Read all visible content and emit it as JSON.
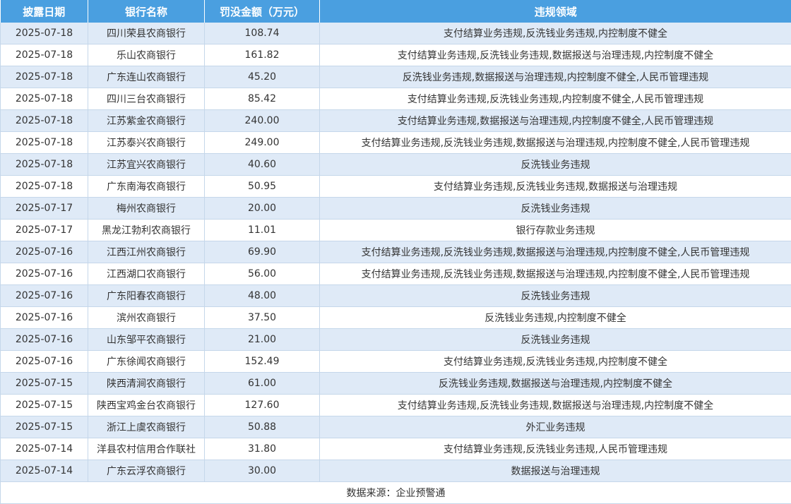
{
  "headers": [
    "披露日期",
    "银行名称",
    "罚没金额（万元）",
    "违规领域"
  ],
  "rows": [
    {
      "date": "2025-07-18",
      "bank": "四川荣县农商银行",
      "amount": "108.74",
      "area": "支付结算业务违规,反洗钱业务违规,内控制度不健全"
    },
    {
      "date": "2025-07-18",
      "bank": "乐山农商银行",
      "amount": "161.82",
      "area": "支付结算业务违规,反洗钱业务违规,数据报送与治理违规,内控制度不健全"
    },
    {
      "date": "2025-07-18",
      "bank": "广东连山农商银行",
      "amount": "45.20",
      "area": "反洗钱业务违规,数据报送与治理违规,内控制度不健全,人民币管理违规"
    },
    {
      "date": "2025-07-18",
      "bank": "四川三台农商银行",
      "amount": "85.42",
      "area": "支付结算业务违规,反洗钱业务违规,内控制度不健全,人民币管理违规"
    },
    {
      "date": "2025-07-18",
      "bank": "江苏紫金农商银行",
      "amount": "240.00",
      "area": "支付结算业务违规,数据报送与治理违规,内控制度不健全,人民币管理违规"
    },
    {
      "date": "2025-07-18",
      "bank": "江苏泰兴农商银行",
      "amount": "249.00",
      "area": "支付结算业务违规,反洗钱业务违规,数据报送与治理违规,内控制度不健全,人民币管理违规"
    },
    {
      "date": "2025-07-18",
      "bank": "江苏宜兴农商银行",
      "amount": "40.60",
      "area": "反洗钱业务违规"
    },
    {
      "date": "2025-07-18",
      "bank": "广东南海农商银行",
      "amount": "50.95",
      "area": "支付结算业务违规,反洗钱业务违规,数据报送与治理违规"
    },
    {
      "date": "2025-07-17",
      "bank": "梅州农商银行",
      "amount": "20.00",
      "area": "反洗钱业务违规"
    },
    {
      "date": "2025-07-17",
      "bank": "黑龙江勃利农商银行",
      "amount": "11.01",
      "area": "银行存款业务违规"
    },
    {
      "date": "2025-07-16",
      "bank": "江西江州农商银行",
      "amount": "69.90",
      "area": "支付结算业务违规,反洗钱业务违规,数据报送与治理违规,内控制度不健全,人民币管理违规"
    },
    {
      "date": "2025-07-16",
      "bank": "江西湖口农商银行",
      "amount": "56.00",
      "area": "支付结算业务违规,反洗钱业务违规,数据报送与治理违规,内控制度不健全,人民币管理违规"
    },
    {
      "date": "2025-07-16",
      "bank": "广东阳春农商银行",
      "amount": "48.00",
      "area": "反洗钱业务违规"
    },
    {
      "date": "2025-07-16",
      "bank": "滨州农商银行",
      "amount": "37.50",
      "area": "反洗钱业务违规,内控制度不健全"
    },
    {
      "date": "2025-07-16",
      "bank": "山东邹平农商银行",
      "amount": "21.00",
      "area": "反洗钱业务违规"
    },
    {
      "date": "2025-07-16",
      "bank": "广东徐闻农商银行",
      "amount": "152.49",
      "area": "支付结算业务违规,反洗钱业务违规,内控制度不健全"
    },
    {
      "date": "2025-07-15",
      "bank": "陕西清涧农商银行",
      "amount": "61.00",
      "area": "反洗钱业务违规,数据报送与治理违规,内控制度不健全"
    },
    {
      "date": "2025-07-15",
      "bank": "陕西宝鸡金台农商银行",
      "amount": "127.60",
      "area": "支付结算业务违规,反洗钱业务违规,数据报送与治理违规,内控制度不健全"
    },
    {
      "date": "2025-07-15",
      "bank": "浙江上虞农商银行",
      "amount": "50.88",
      "area": "外汇业务违规"
    },
    {
      "date": "2025-07-14",
      "bank": "洋县农村信用合作联社",
      "amount": "31.80",
      "area": "支付结算业务违规,反洗钱业务违规,人民币管理违规"
    },
    {
      "date": "2025-07-14",
      "bank": "广东云浮农商银行",
      "amount": "30.00",
      "area": "数据报送与治理违规"
    }
  ],
  "footer": "数据来源：企业预警通",
  "colors": {
    "header_bg": "#4a9fe0",
    "stripe": "#dfeaf7",
    "border": "#c5d7ea"
  }
}
